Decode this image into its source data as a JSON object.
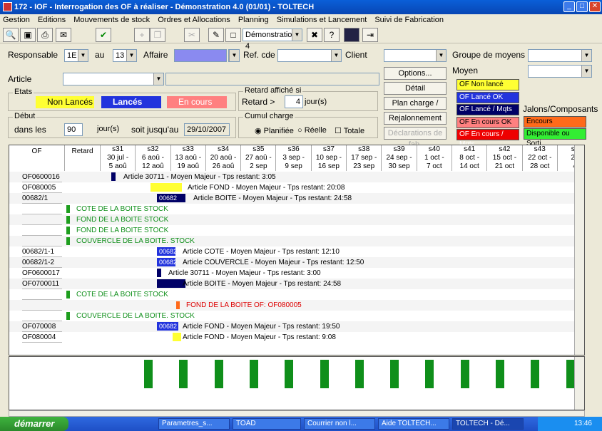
{
  "window": {
    "title": "172 - IOF - Interrogation des OF à réaliser - Démonstration 4.0 (01/01) - TOLTECH"
  },
  "menu": [
    "Gestion",
    "Editions",
    "Mouvements de stock",
    "Ordres et Allocations",
    "Planning",
    "Simulations et Lancement",
    "Suivi de Fabrication"
  ],
  "toolbar": {
    "company": "Démonstration 4"
  },
  "filters": {
    "responsable_label": "Responsable",
    "responsable_from": "1E",
    "au_label": "au",
    "responsable_to": "13",
    "affaire_label": "Affaire",
    "refcde_label": "Ref. cde",
    "client_label": "Client",
    "groupe_label": "Groupe de moyens",
    "moyen_label": "Moyen",
    "article_label": "Article"
  },
  "etats": {
    "label": "Etats",
    "non_lances": "Non Lancés",
    "lances": "Lancés",
    "en_cours": "En cours"
  },
  "retard": {
    "label": "Retard affiché si",
    "retard_label": "Retard >",
    "value": "4",
    "unit": "jour(s)"
  },
  "debut": {
    "label": "Début",
    "dans_les": "dans les",
    "days": "90",
    "unit": "jour(s)",
    "soit": "soit jusqu'au",
    "date": "29/10/2007"
  },
  "cumul": {
    "label": "Cumul charge",
    "planifiee": "Planifiée",
    "reelle": "Réelle",
    "totale": "Totale"
  },
  "buttons": {
    "options": "Options...",
    "detail": "Détail",
    "plan": "Plan charge / sem.",
    "rejalonnement": "Rejalonnement",
    "declarations": "Déclarations de fab."
  },
  "legend": [
    {
      "label": "OF Non lancé",
      "bg": "#ffff33",
      "fg": "#000"
    },
    {
      "label": "OF Lancé OK",
      "bg": "#2233dd",
      "fg": "#fff"
    },
    {
      "label": "OF Lancé / Mqts",
      "bg": "#000066",
      "fg": "#fff"
    },
    {
      "label": "OF En cours OK",
      "bg": "#ff8080",
      "fg": "#000"
    },
    {
      "label": "OF En cours / Mqts",
      "bg": "#ee0000",
      "fg": "#fff"
    }
  ],
  "jalons": {
    "label": "Jalons/Composants",
    "encours": "Encours",
    "dispo": "Disponible ou Sorti"
  },
  "grid": {
    "col_of": "OF",
    "col_retard": "Retard",
    "weeks": [
      {
        "w": "s31",
        "d1": "30 jul -",
        "d2": "5 aoû"
      },
      {
        "w": "s32",
        "d1": "6 aoû -",
        "d2": "12 aoû"
      },
      {
        "w": "s33",
        "d1": "13 aoû -",
        "d2": "19 aoû"
      },
      {
        "w": "s34",
        "d1": "20 aoû -",
        "d2": "26 aoû"
      },
      {
        "w": "s35",
        "d1": "27 aoû -",
        "d2": "2 sep"
      },
      {
        "w": "s36",
        "d1": "3 sep -",
        "d2": "9 sep"
      },
      {
        "w": "s37",
        "d1": "10 sep -",
        "d2": "16 sep"
      },
      {
        "w": "s38",
        "d1": "17 sep -",
        "d2": "23 sep"
      },
      {
        "w": "s39",
        "d1": "24 sep -",
        "d2": "30 sep"
      },
      {
        "w": "s40",
        "d1": "1 oct -",
        "d2": "7 oct"
      },
      {
        "w": "s41",
        "d1": "8 oct -",
        "d2": "14 oct"
      },
      {
        "w": "s42",
        "d1": "15 oct -",
        "d2": "21 oct"
      },
      {
        "w": "s43",
        "d1": "22 oct -",
        "d2": "28 oct"
      },
      {
        "w": "s4",
        "d1": "29",
        "d2": "4"
      }
    ],
    "rows": [
      {
        "of": "OF0600016",
        "text": "Article 30711 - Moyen Majeur - Tps restant: 3:05",
        "bar": "",
        "color": "#000066",
        "type": "of"
      },
      {
        "of": "OF080005",
        "text": "Article FOND - Moyen Majeur - Tps restant: 20:08",
        "bar": "",
        "color": "#ffff33",
        "type": "of"
      },
      {
        "of": "00682/1",
        "text": "Article BOITE - Moyen Majeur - Tps restant: 24:58",
        "bar": "00682",
        "color": "#000066",
        "type": "of"
      },
      {
        "of": "",
        "text": "COTE DE LA BOITE STOCK",
        "type": "comp"
      },
      {
        "of": "",
        "text": "FOND DE LA BOITE STOCK",
        "type": "comp"
      },
      {
        "of": "",
        "text": "FOND DE LA BOITE STOCK",
        "type": "comp"
      },
      {
        "of": "",
        "text": "COUVERCLE DE LA BOITE. STOCK",
        "type": "comp"
      },
      {
        "of": "00682/1-1",
        "text": "Article COTE - Moyen Majeur - Tps restant: 12:10",
        "bar": "00682",
        "color": "#2233dd",
        "type": "of"
      },
      {
        "of": "00682/1-2",
        "text": "Article COUVERCLE - Moyen Majeur - Tps restant: 12:50",
        "bar": "00682",
        "color": "#2233dd",
        "type": "of"
      },
      {
        "of": "OF0600017",
        "text": "Article 30711 - Moyen Majeur - Tps restant: 3:00",
        "bar": "",
        "color": "#000066",
        "type": "of"
      },
      {
        "of": "OF0700011",
        "text": "Article BOITE - Moyen Majeur - Tps restant: 24:58",
        "bar": "",
        "color": "#000066",
        "type": "of"
      },
      {
        "of": "",
        "text": "COTE DE LA BOITE STOCK",
        "type": "comp"
      },
      {
        "of": "",
        "text": "FOND DE LA BOITE OF: OF080005",
        "type": "red"
      },
      {
        "of": "",
        "text": "COUVERCLE DE LA BOITE. STOCK",
        "type": "comp"
      },
      {
        "of": "OF070008",
        "text": "Article FOND - Moyen Majeur - Tps restant: 19:50",
        "bar": "00682",
        "color": "#2233dd",
        "type": "of"
      },
      {
        "of": "OF080004",
        "text": "Article FOND - Moyen Majeur - Tps restant: 9:08",
        "bar": "",
        "color": "#ffff33",
        "type": "of"
      }
    ]
  },
  "taskbar": {
    "start": "démarrer",
    "tasks": [
      "Parametres_s...",
      "TOAD",
      "Courrier non l...",
      "Aide TOLTECH...",
      "TOLTECH - Dé..."
    ],
    "clock": "13:46"
  }
}
